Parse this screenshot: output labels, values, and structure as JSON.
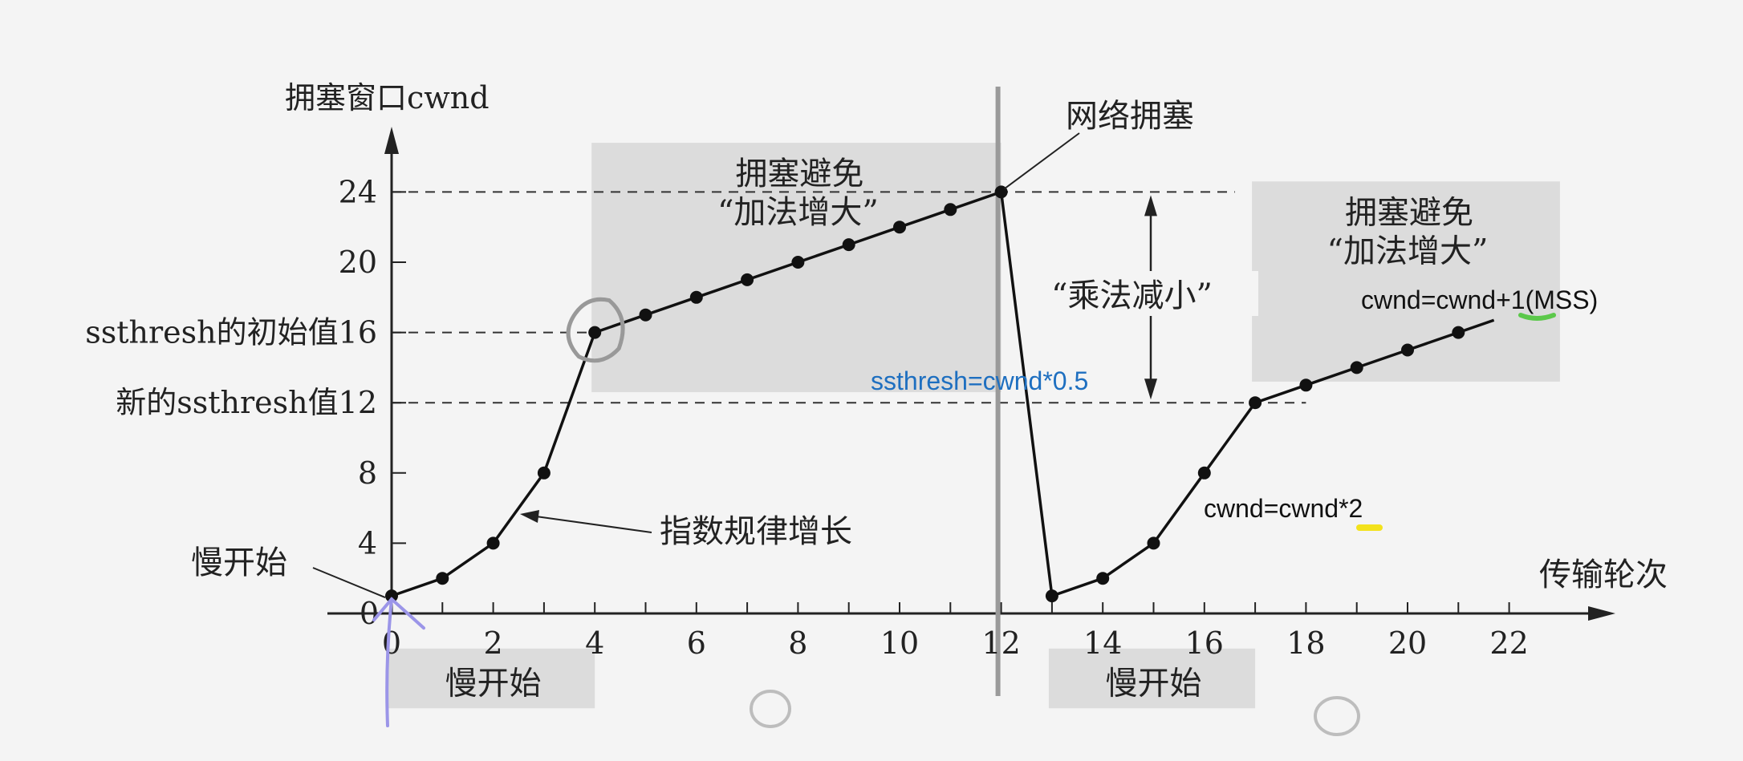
{
  "chart_data": {
    "type": "line",
    "ylabel": "拥塞窗口cwnd",
    "xlabel": "传输轮次",
    "xlim": [
      0,
      23
    ],
    "ylim": [
      0,
      27
    ],
    "x_ticks": [
      0,
      2,
      4,
      6,
      8,
      10,
      12,
      14,
      16,
      18,
      20,
      22
    ],
    "y_ticks": [
      0,
      4,
      8,
      12,
      16,
      20,
      24
    ],
    "y_tick_prefix": {
      "16": "ssthresh的初始值",
      "12": "新的ssthresh值"
    },
    "series": [
      {
        "points": [
          [
            0,
            1
          ],
          [
            1,
            2
          ],
          [
            2,
            4
          ],
          [
            3,
            8
          ],
          [
            4,
            16
          ],
          [
            5,
            17
          ],
          [
            6,
            18
          ],
          [
            7,
            19
          ],
          [
            8,
            20
          ],
          [
            9,
            21
          ],
          [
            10,
            22
          ],
          [
            11,
            23
          ],
          [
            12,
            24
          ],
          [
            13,
            1
          ],
          [
            14,
            2
          ],
          [
            15,
            4
          ],
          [
            16,
            8
          ],
          [
            17,
            12
          ],
          [
            18,
            13
          ],
          [
            19,
            14
          ],
          [
            20,
            15
          ],
          [
            21,
            16
          ]
        ],
        "trailing_segment": [
          [
            21,
            16
          ],
          [
            21.7,
            16.7
          ]
        ]
      }
    ],
    "reference_lines": [
      24,
      16,
      12
    ],
    "regions": [
      {
        "x": [
          4,
          12
        ],
        "y": [
          12.6,
          26.8
        ],
        "label_line1": "拥塞避免",
        "label_line2": "“加法增大”"
      },
      {
        "x": [
          17,
          23
        ],
        "y": [
          13.2,
          24.6
        ],
        "label_line1": "拥塞避免",
        "label_line2": "“加法增大”"
      },
      {
        "x": [
          0,
          4
        ],
        "y": [
          -5.4,
          -2.0
        ],
        "label": "慢开始"
      },
      {
        "x": [
          13,
          17
        ],
        "y": [
          -5.4,
          -2.0
        ],
        "label": "慢开始"
      }
    ],
    "annotations": {
      "network_congestion": "网络拥塞",
      "multiplicative_decrease": "“乘法减小”",
      "exponential_growth": "指数规律增长",
      "slow_start_left": "慢开始",
      "ssthresh_formula": "ssthresh=cwnd*0.5",
      "additive_formula": "cwnd=cwnd+1(MSS)",
      "double_formula": "cwnd=cwnd*2"
    },
    "grid": false,
    "colors": {
      "line": "#111111",
      "region": "#dcdcdc",
      "ssthresh_formula": "#1e6fc0",
      "marker_green": "#5bc84a",
      "marker_yellow": "#f3e21c",
      "pen_blue": "#9b95e8",
      "circle_gray": "#999999",
      "vertical_gray": "#9a9a9a"
    }
  }
}
